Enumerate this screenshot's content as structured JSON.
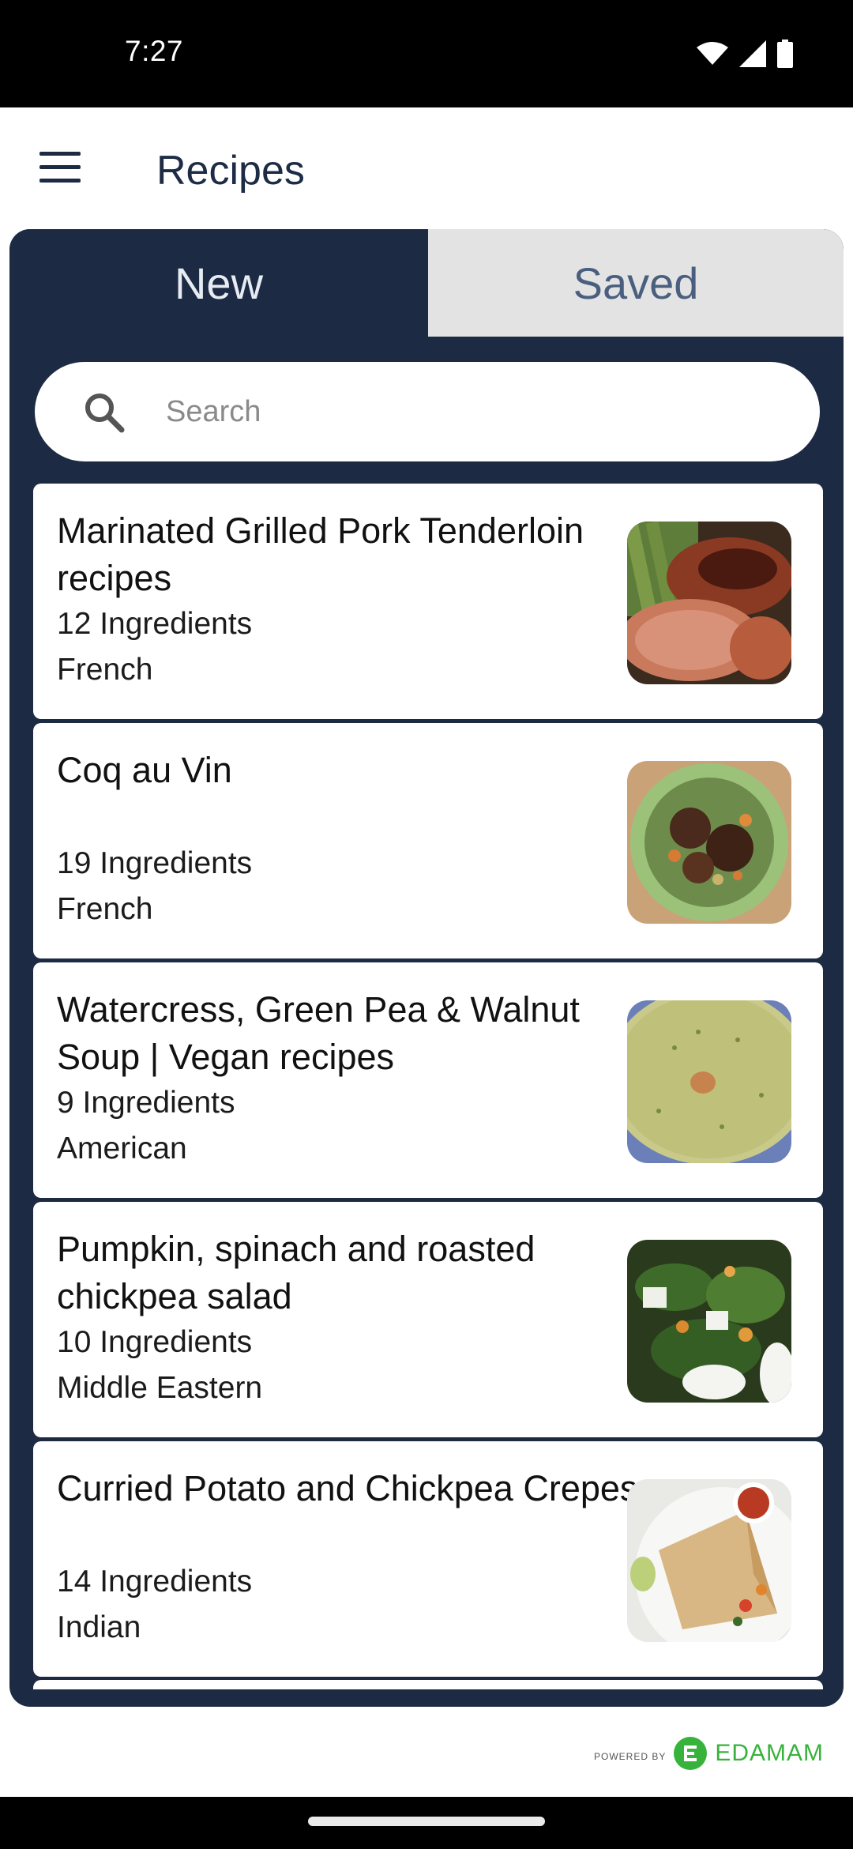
{
  "status": {
    "time": "7:27"
  },
  "app_bar": {
    "title": "Recipes"
  },
  "tabs": [
    {
      "label": "New",
      "active": true
    },
    {
      "label": "Saved",
      "active": false
    }
  ],
  "search": {
    "placeholder": "Search",
    "value": ""
  },
  "recipes": [
    {
      "title": "Marinated Grilled Pork Tenderloin recipes",
      "ingredients": "12 Ingredients",
      "cuisine": "French",
      "image": "grilled-pork-photo"
    },
    {
      "title": "Coq au Vin",
      "ingredients": "19 Ingredients",
      "cuisine": "French",
      "image": "coq-au-vin-photo"
    },
    {
      "title": "Watercress, Green Pea & Walnut Soup | Vegan recipes",
      "ingredients": "9 Ingredients",
      "cuisine": "American",
      "image": "green-soup-photo"
    },
    {
      "title": "Pumpkin, spinach and roasted chickpea salad",
      "ingredients": "10 Ingredients",
      "cuisine": "Middle Eastern",
      "image": "salad-photo"
    },
    {
      "title": "Curried Potato and Chickpea Crepes",
      "ingredients": "14 Ingredients",
      "cuisine": "Indian",
      "image": "crepe-photo"
    }
  ],
  "footer": {
    "powered_by": "POWERED BY",
    "brand": "EDAMAM"
  },
  "colors": {
    "primary": "#1d2a44",
    "brand_green": "#37b33b"
  }
}
